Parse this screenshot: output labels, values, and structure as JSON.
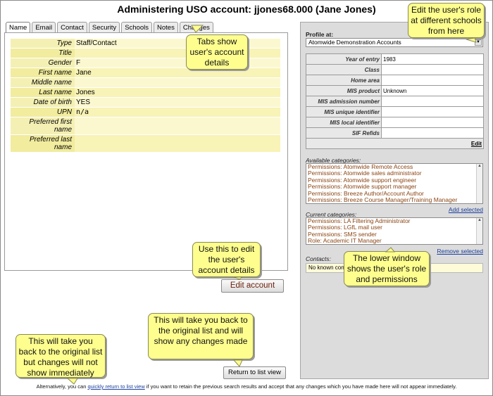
{
  "page_title": "Administering USO account: jjones68.000 (Jane Jones)",
  "tabs": [
    "Name",
    "Email",
    "Contact",
    "Security",
    "Schools",
    "Notes",
    "Changes"
  ],
  "details": [
    {
      "label": "Type",
      "value": "Staff/Contact"
    },
    {
      "label": "Title",
      "value": ""
    },
    {
      "label": "Gender",
      "value": "F"
    },
    {
      "label": "First name",
      "value": "Jane"
    },
    {
      "label": "Middle name",
      "value": ""
    },
    {
      "label": "Last name",
      "value": "Jones"
    },
    {
      "label": "Date of birth",
      "value": "YES"
    },
    {
      "label": "UPN",
      "value": "n/a"
    },
    {
      "label": "Preferred first name",
      "value": ""
    },
    {
      "label": "Preferred last name",
      "value": ""
    }
  ],
  "edit_account_label": "Edit account",
  "return_button_label": "Return to list view",
  "right_panel": {
    "profile_label": "Profile at:",
    "profile_selected": "Atomwide Demonstration Accounts",
    "info_rows": [
      {
        "label": "Year of entry",
        "value": "1983"
      },
      {
        "label": "Class",
        "value": ""
      },
      {
        "label": "Home area",
        "value": ""
      },
      {
        "label": "MIS product",
        "value": "Unknown"
      },
      {
        "label": "MIS admission number",
        "value": ""
      },
      {
        "label": "MIS unique identifier",
        "value": ""
      },
      {
        "label": "MIS local identifier",
        "value": ""
      },
      {
        "label": "SIF Refids",
        "value": ""
      }
    ],
    "edit_link": "Edit",
    "available_label": "Available categories:",
    "available": [
      "Permissions: Atomwide Remote Access",
      "Permissions: Atomwide sales administrator",
      "Permissions: Atomwide support engineer",
      "Permissions: Atomwide support manager",
      "Permissions: Breeze Author/Account Author",
      "Permissions: Breeze Course Manager/Training Manager"
    ],
    "add_selected": "Add selected",
    "current_label": "Current categories:",
    "current": [
      "Permissions: LA Filtering Administrator",
      "Permissions: LGfL mail user",
      "Permissions: SMS sender",
      "Role: Academic IT Manager"
    ],
    "remove_selected": "Remove selected",
    "contacts_label": "Contacts:",
    "contacts_value": "No known con"
  },
  "callouts": {
    "tabs": "Tabs show user's account details",
    "edit_role": "Edit the user's role at different schools from here",
    "edit_account": "Use this to edit the user's account details",
    "lower_window": "The lower window shows the user's role and permissions",
    "return_list": "This will take you back to the original list and will show any changes made",
    "quick_return": "This will take you back to the original list but changes will not show immediately"
  },
  "footer": {
    "prefix": "Alternatively, you can ",
    "link": "quickly return to list view",
    "suffix": " if you want to retain the previous search results and accept that any changes which you have made here will not appear immediately."
  }
}
